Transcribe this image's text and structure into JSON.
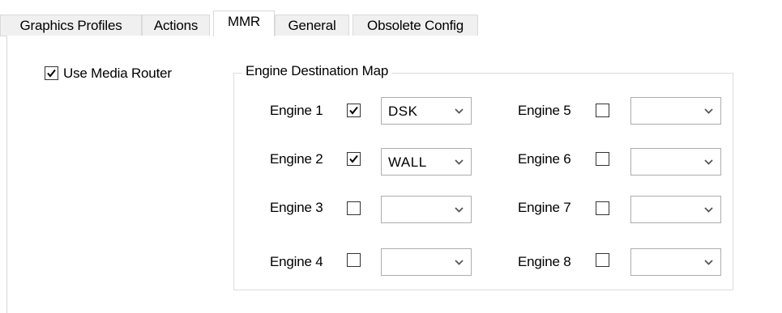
{
  "tabs": [
    {
      "label": "Graphics Profiles",
      "active": false
    },
    {
      "label": "Actions",
      "active": false
    },
    {
      "label": "MMR",
      "active": true
    },
    {
      "label": "General",
      "active": false
    },
    {
      "label": "Obsolete Config",
      "active": false
    }
  ],
  "mmr": {
    "use_media_router": {
      "label": "Use Media Router",
      "checked": true
    },
    "destination_group_title": "Engine Destination Map",
    "engines": [
      {
        "label": "Engine 1",
        "checked": true,
        "destination": "DSK"
      },
      {
        "label": "Engine 2",
        "checked": true,
        "destination": "WALL"
      },
      {
        "label": "Engine 3",
        "checked": false,
        "destination": ""
      },
      {
        "label": "Engine 4",
        "checked": false,
        "destination": ""
      },
      {
        "label": "Engine 5",
        "checked": false,
        "destination": ""
      },
      {
        "label": "Engine 6",
        "checked": false,
        "destination": ""
      },
      {
        "label": "Engine 7",
        "checked": false,
        "destination": ""
      },
      {
        "label": "Engine 8",
        "checked": false,
        "destination": ""
      }
    ]
  }
}
